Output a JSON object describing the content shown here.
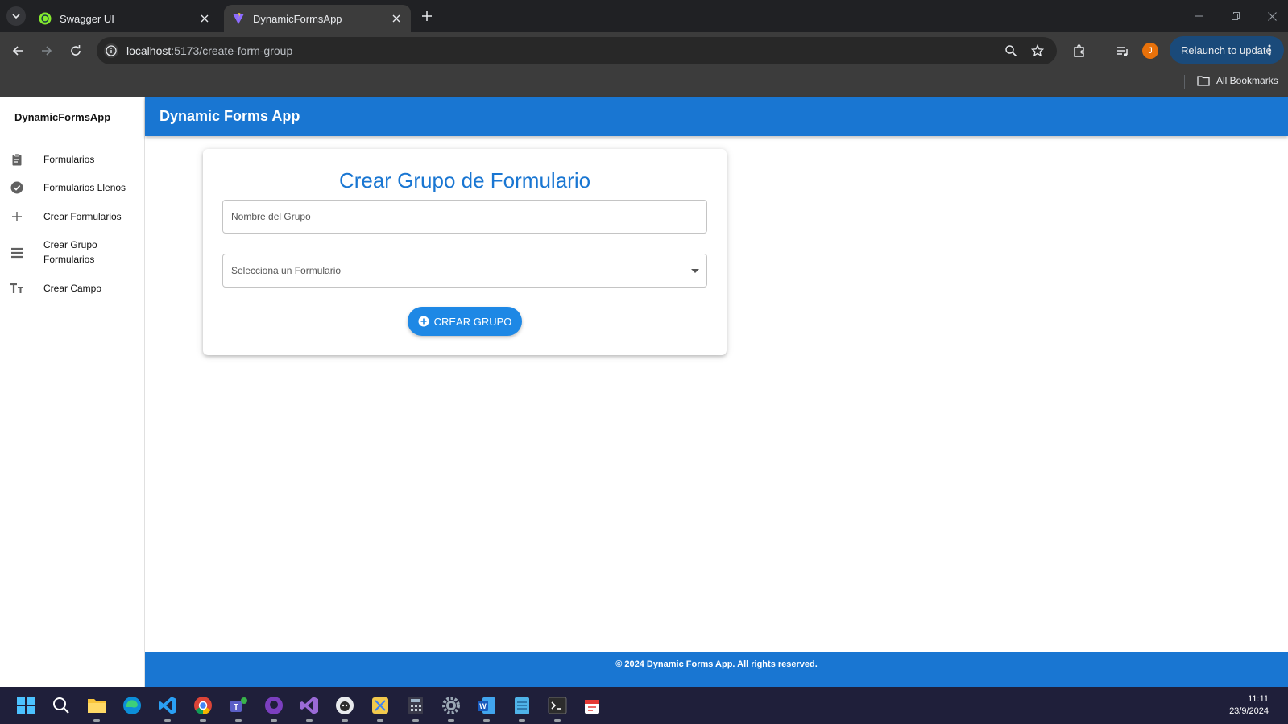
{
  "browser": {
    "tabs": [
      {
        "title": "Swagger UI",
        "favicon": "swagger-icon",
        "active": false
      },
      {
        "title": "DynamicFormsApp",
        "favicon": "vite-icon",
        "active": true
      }
    ],
    "url_host": "localhost",
    "url_rest": ":5173/create-form-group",
    "relaunch_label": "Relaunch to update",
    "profile_initial": "J",
    "bookmarks_label": "All Bookmarks"
  },
  "sidebar": {
    "title": "DynamicFormsApp",
    "items": [
      {
        "label": "Formularios",
        "icon": "clipboard-icon"
      },
      {
        "label": "Formularios Llenos",
        "icon": "check-circle-icon"
      },
      {
        "label": "Crear Formularios",
        "icon": "plus-icon"
      },
      {
        "label": "Crear Grupo Formularios",
        "icon": "list-icon"
      },
      {
        "label": "Crear Campo",
        "icon": "text-fields-icon"
      }
    ]
  },
  "appbar": {
    "title": "Dynamic Forms App"
  },
  "form": {
    "title": "Crear Grupo de Formulario",
    "group_name_placeholder": "Nombre del Grupo",
    "select_label": "Selecciona un Formulario",
    "submit_label": "CREAR GRUPO"
  },
  "footer": {
    "text": "© 2024 Dynamic Forms App. All rights reserved."
  },
  "taskbar": {
    "apps": [
      "windows-start-icon",
      "search-icon",
      "file-explorer-icon",
      "edge-icon",
      "vscode-icon",
      "chrome-icon",
      "teams-icon",
      "github-desktop-icon",
      "visual-studio-icon",
      "app-icon",
      "snipping-tool-icon",
      "calculator-icon",
      "settings-icon",
      "word-icon",
      "notepad-icon",
      "terminal-icon",
      "tool-icon"
    ],
    "time": "11:11",
    "date": "23/9/2024"
  },
  "colors": {
    "primary": "#1976d2",
    "button": "#1e88e5",
    "profile": "#e8710a"
  }
}
